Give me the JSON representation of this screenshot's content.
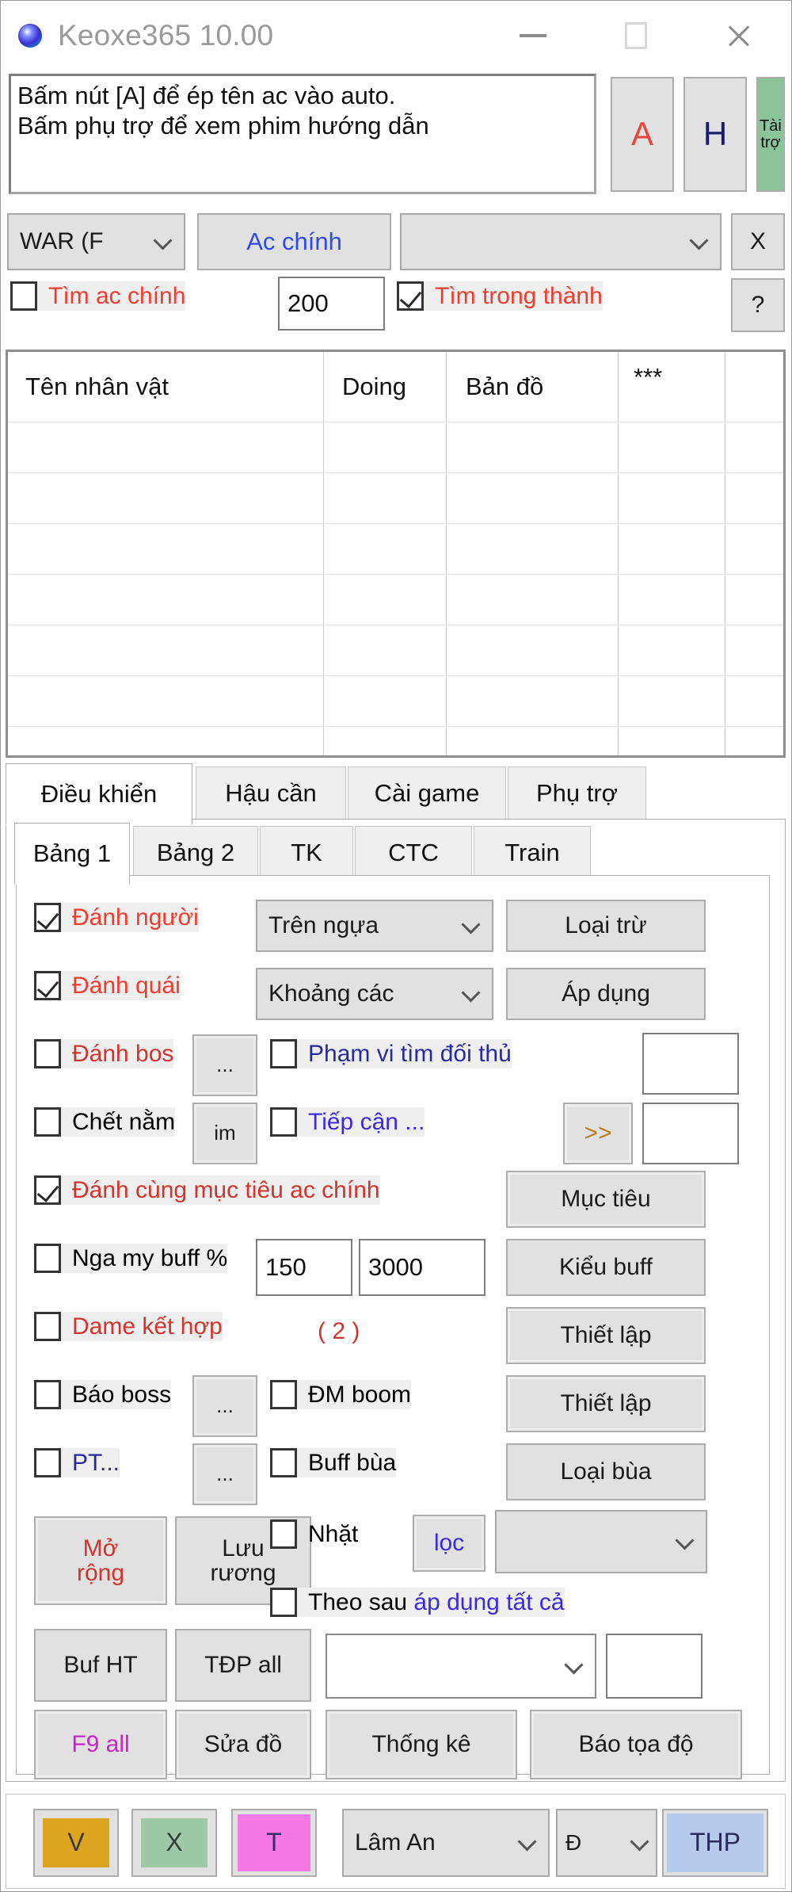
{
  "window": {
    "title": "Keoxe365 10.00",
    "icon": "app-globe-icon",
    "minimize": "—",
    "maximize": "□",
    "close": "✕"
  },
  "memo": {
    "text": "Bấm nút [A] để ép tên ac vào auto.\nBấm phụ trợ để xem phim hướng dẫn"
  },
  "top_buttons": {
    "a": "A",
    "h": "H",
    "sponsor_line1": "Tài",
    "sponsor_line2": "trợ"
  },
  "filter_row": {
    "server_combo": "WAR (F",
    "main_account_button": "Ac chính",
    "account_combo": "",
    "close_button": "X"
  },
  "search_row": {
    "find_main_label": "Tìm ac chính",
    "find_main_checked": false,
    "range_value": "200",
    "find_in_town_label": "Tìm trong thành",
    "find_in_town_checked": true,
    "help_button": "?"
  },
  "grid": {
    "columns": [
      "Tên nhân vật",
      "Doing",
      "Bản đồ",
      "***",
      ""
    ],
    "rows": []
  },
  "tabs": [
    {
      "label": "Điều khiển",
      "active": true
    },
    {
      "label": "Hậu cần",
      "active": false
    },
    {
      "label": "Cài game",
      "active": false
    },
    {
      "label": "Phụ trợ",
      "active": false
    }
  ],
  "subtabs": [
    {
      "label": "Bảng 1",
      "active": true
    },
    {
      "label": "Bảng 2",
      "active": false
    },
    {
      "label": "TK",
      "active": false
    },
    {
      "label": "CTC",
      "active": false
    },
    {
      "label": "Train",
      "active": false
    }
  ],
  "panel": {
    "row1": {
      "check_label": "Đánh người",
      "checked": true,
      "combo": "Trên ngựa",
      "button": "Loại trừ"
    },
    "row2": {
      "check_label": "Đánh quái",
      "checked": true,
      "combo": "Khoảng các",
      "button": "Áp dụng"
    },
    "row3": {
      "check_label": "Đánh bos",
      "checked": false,
      "dots_button": "...",
      "check2_label": "Phạm vi tìm đối thủ",
      "check2_checked": false,
      "field": ""
    },
    "row4": {
      "check_label": "Chết nằm",
      "checked": false,
      "im_button": "im",
      "check2_label": "Tiếp cận ...",
      "check2_checked": false,
      "arrow_button": ">>",
      "field": ""
    },
    "row5": {
      "check_label": "Đánh cùng mục tiêu ac chính",
      "checked": true,
      "button": "Mục tiêu"
    },
    "row6": {
      "check_label": "Nga my buff %",
      "checked": false,
      "value1": "150",
      "value2": "3000",
      "button": "Kiểu buff"
    },
    "row7": {
      "check_label": "Dame kết hợp",
      "checked": false,
      "count": "( 2 )",
      "button": "Thiết lập"
    },
    "row8": {
      "check_label": "Báo boss",
      "checked": false,
      "dots_button": "...",
      "check2_label": "ĐM boom",
      "check2_checked": false,
      "button": "Thiết lập"
    },
    "row9": {
      "check_label": "PT...",
      "checked": false,
      "dots_button": "...",
      "check2_label": "Buff bùa",
      "check2_checked": false,
      "button": "Loại bùa"
    },
    "row10": {
      "open_button_l1": "Mở",
      "open_button_l2": "rộng",
      "save_button_l1": "Lưu",
      "save_button_l2": "rương",
      "pickup_label": "Nhặt",
      "pickup_checked": false,
      "filter_button": "lọc",
      "filter_combo": ""
    },
    "row11": {
      "follow_prefix": "Theo sau ",
      "follow_link": "áp dụng tất cả",
      "follow_checked": false
    },
    "row12": {
      "buf_ht_button": "Buf HT",
      "tdp_all_button": "TĐP all",
      "follow_combo": "",
      "follow_field": ""
    },
    "row13": {
      "f9_all_button": "F9 all",
      "fix_gear_button": "Sửa đồ",
      "stats_button": "Thống kê",
      "report_coord_button": "Báo tọa độ"
    }
  },
  "statusbar": {
    "v_button": "V",
    "x_button": "X",
    "t_button": "T",
    "server_combo": "Lâm An",
    "short_combo": "Đ",
    "thp_button": "THP"
  },
  "colors": {
    "red": "#f03b2d",
    "blue": "#2f49f0",
    "magenta": "#cc22cc",
    "green_btn": "#8cc49a",
    "gold_btn": "#dda51f",
    "pink_btn": "#f57ae8",
    "lightblue_btn": "#b6caeb",
    "title_gray": "#9a9a9a"
  }
}
